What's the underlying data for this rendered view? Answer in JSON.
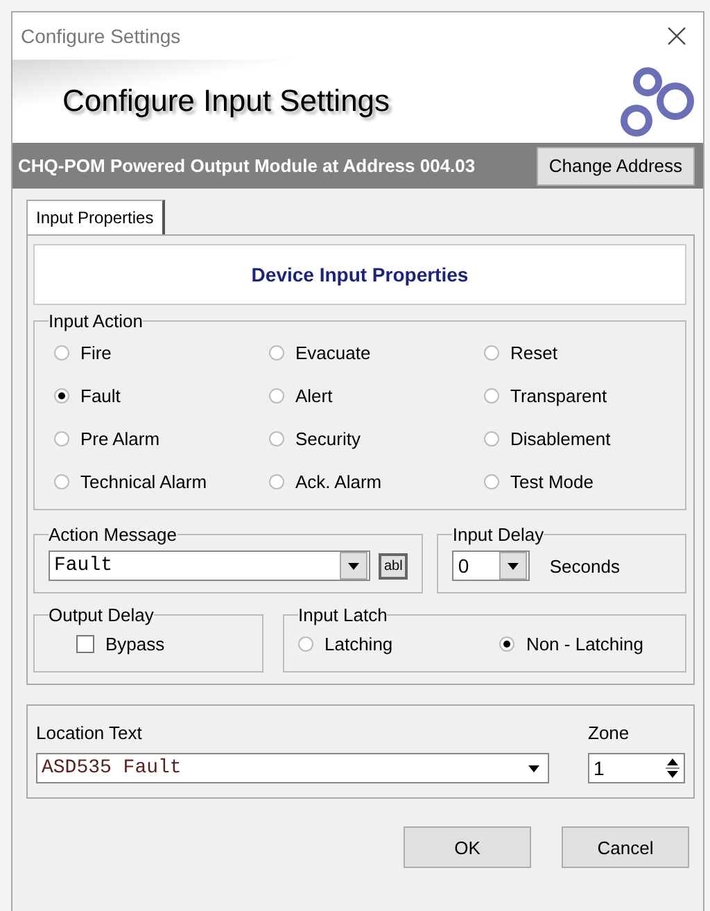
{
  "window": {
    "title": "Configure Settings"
  },
  "banner": {
    "title": "Configure Input Settings"
  },
  "device": {
    "description": "CHQ-POM Powered Output Module at Address 004.03",
    "button": "Change Address"
  },
  "tabs": [
    {
      "label": "Input Properties",
      "selected": true
    }
  ],
  "panel_title": "Device Input Properties",
  "input_action": {
    "label": "Input Action",
    "options": [
      {
        "label": "Fire",
        "selected": false
      },
      {
        "label": "Evacuate",
        "selected": false
      },
      {
        "label": "Reset",
        "selected": false
      },
      {
        "label": "Fault",
        "selected": true
      },
      {
        "label": "Alert",
        "selected": false
      },
      {
        "label": "Transparent",
        "selected": false
      },
      {
        "label": "Pre Alarm",
        "selected": false
      },
      {
        "label": "Security",
        "selected": false
      },
      {
        "label": "Disablement",
        "selected": false
      },
      {
        "label": "Technical Alarm",
        "selected": false
      },
      {
        "label": "Ack. Alarm",
        "selected": false
      },
      {
        "label": "Test Mode",
        "selected": false
      }
    ]
  },
  "action_message": {
    "label": "Action Message",
    "value": "Fault",
    "button": "abl"
  },
  "input_delay": {
    "label": "Input Delay",
    "value": "0",
    "unit": "Seconds"
  },
  "output_delay": {
    "label": "Output Delay",
    "bypass": {
      "label": "Bypass",
      "checked": false
    }
  },
  "input_latch": {
    "label": "Input Latch",
    "options": [
      {
        "label": "Latching",
        "selected": false
      },
      {
        "label": "Non - Latching",
        "selected": true
      }
    ]
  },
  "location": {
    "label": "Location Text",
    "value": "ASD535 Fault"
  },
  "zone": {
    "label": "Zone",
    "value": "1"
  },
  "buttons": [
    "OK",
    "Cancel"
  ]
}
